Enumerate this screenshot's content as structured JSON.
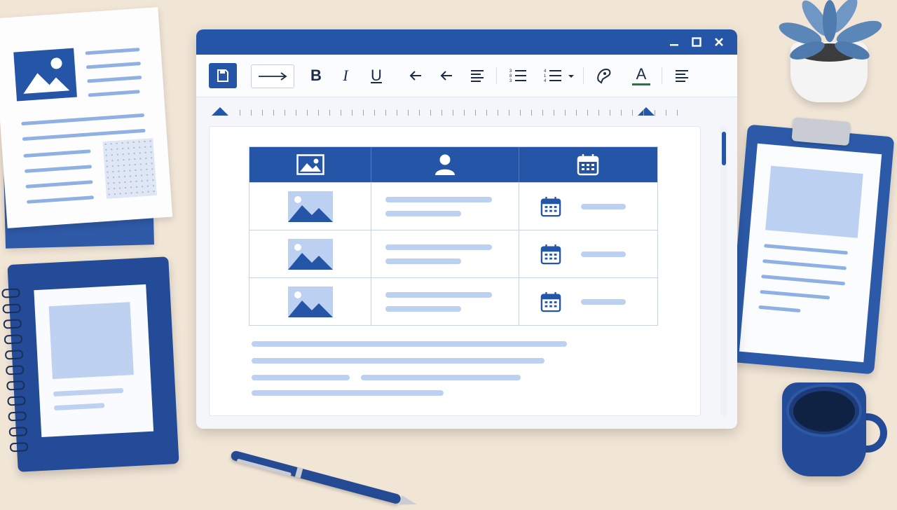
{
  "window": {
    "controls": [
      "minimize-icon",
      "maximize-icon",
      "close-icon"
    ]
  },
  "toolbar": {
    "items": [
      {
        "name": "save-icon"
      },
      {
        "name": "arrow-style-icon"
      },
      {
        "name": "bold-icon",
        "label": "B"
      },
      {
        "name": "italic-icon",
        "label": "I"
      },
      {
        "name": "underline-icon",
        "label": "U"
      },
      {
        "name": "undo-icon"
      },
      {
        "name": "redo-icon"
      },
      {
        "name": "align-left-icon"
      },
      {
        "name": "numbered-list-icon"
      },
      {
        "name": "numbered-list-dropdown-icon"
      },
      {
        "name": "highlighter-icon"
      },
      {
        "name": "font-color-icon",
        "label": "A"
      },
      {
        "name": "align-text-icon"
      }
    ]
  },
  "table": {
    "header_icons": [
      "image-icon",
      "user-icon",
      "calendar-icon"
    ],
    "rows": [
      {
        "image": "image-icon",
        "date_icon": "calendar-icon"
      },
      {
        "image": "image-icon",
        "date_icon": "calendar-icon"
      },
      {
        "image": "image-icon",
        "date_icon": "calendar-icon"
      }
    ]
  },
  "colors": {
    "accent": "#2455a6",
    "placeholder_line": "#bcd0f2",
    "desk": "#f1e5d6",
    "font_color_underline": "#1e7a3a"
  }
}
